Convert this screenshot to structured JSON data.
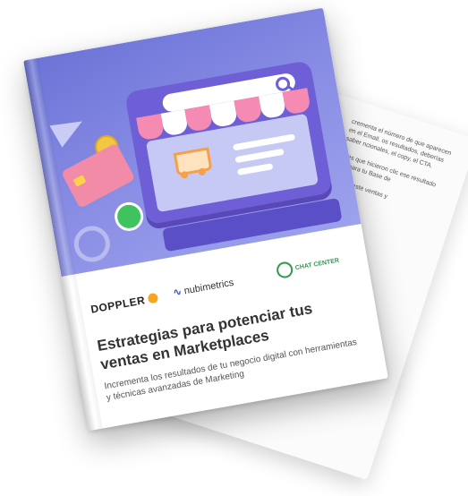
{
  "back_page": {
    "paragraphs": [
      "crementa el número de que aparecen en el Email. os resultados, deberías saber ncionales, el copy, el CTA.",
      "ones que hicieron clic ese resultado por para tu Base de",
      "ejia de este ventas y"
    ]
  },
  "cover": {
    "logos": {
      "doppler": "DOPPLER",
      "nubimetrics": "nubimetrics",
      "chatcenter": "CHAT CENTER"
    },
    "title": "Estrategias para potenciar tus ventas en Marketplaces",
    "subtitle": "Incrementa los resultados de tu negocio digital con herramientas y técnicas avanzadas de Marketing",
    "colors": {
      "hero_start": "#6b73d6",
      "hero_end": "#9ca2ec",
      "monitor": "#6e5fd6",
      "awning_pink": "#f58ab2",
      "doppler_accent": "#f7a51c"
    }
  }
}
